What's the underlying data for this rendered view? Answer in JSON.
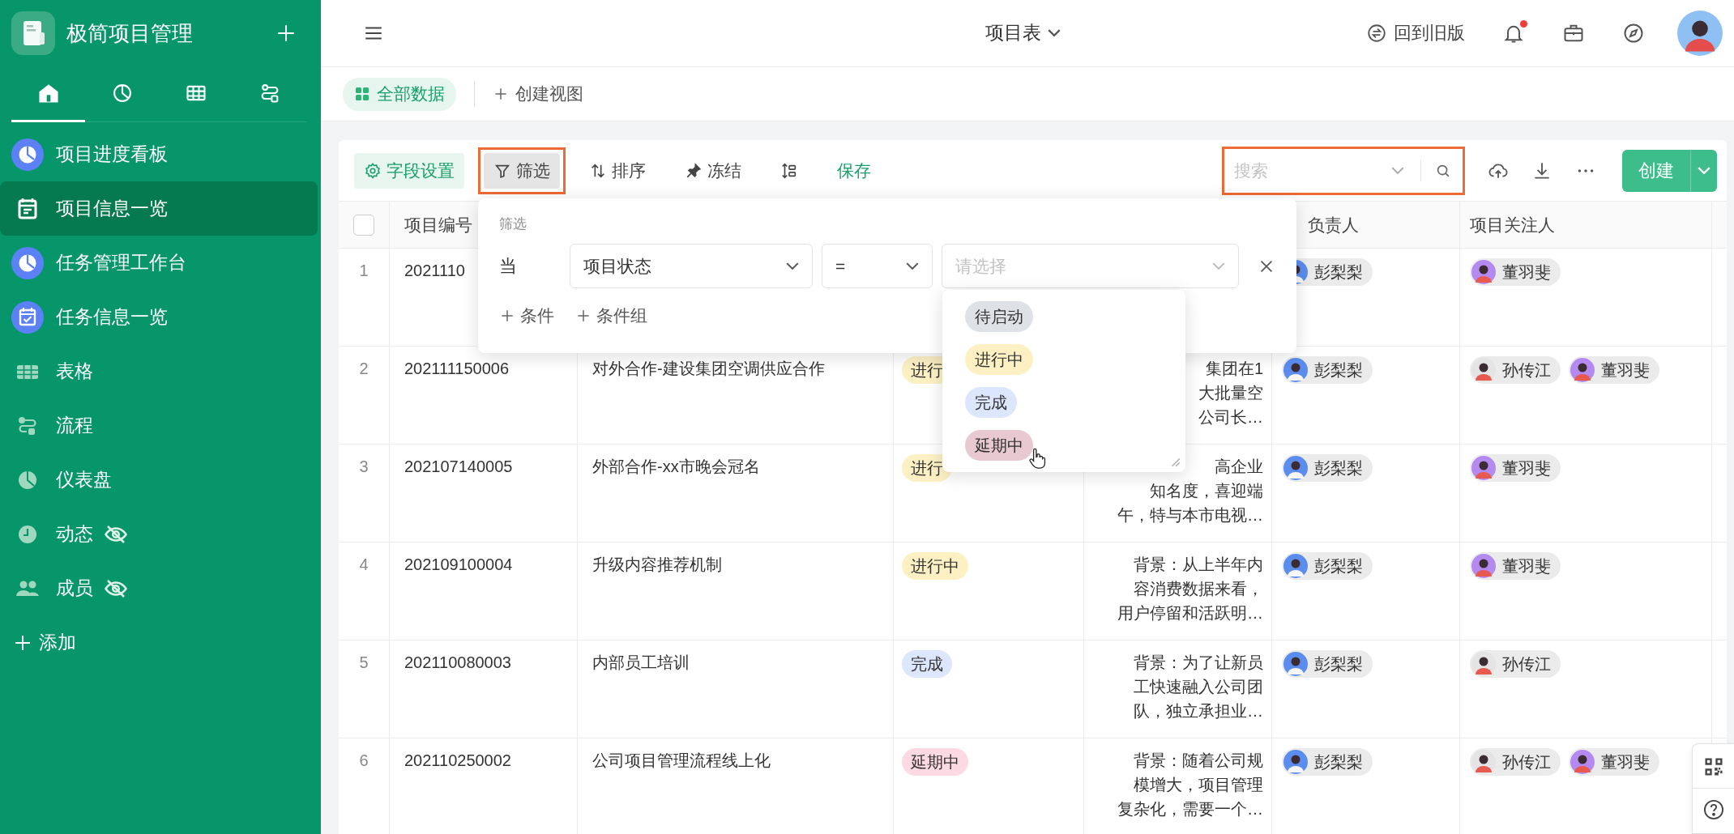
{
  "sidebar": {
    "app_title": "极简项目管理",
    "tabs": [
      {
        "kind": "home",
        "selected": true
      },
      {
        "kind": "chart",
        "selected": false
      },
      {
        "kind": "table",
        "selected": false
      },
      {
        "kind": "flow",
        "selected": false
      }
    ],
    "items": [
      {
        "label": "项目进度看板",
        "kind": "dashboard",
        "selected": false,
        "hidden": false
      },
      {
        "label": "项目信息一览",
        "kind": "form",
        "selected": true,
        "hidden": false
      },
      {
        "label": "任务管理工作台",
        "kind": "dashboard",
        "selected": false,
        "hidden": false
      },
      {
        "label": "任务信息一览",
        "kind": "task_form",
        "selected": false,
        "hidden": false
      },
      {
        "label": "表格",
        "kind": "table",
        "selected": false,
        "hidden": false
      },
      {
        "label": "流程",
        "kind": "flow",
        "selected": false,
        "hidden": false
      },
      {
        "label": "仪表盘",
        "kind": "chart",
        "selected": false,
        "hidden": false
      },
      {
        "label": "动态",
        "kind": "activity",
        "selected": false,
        "hidden": true
      },
      {
        "label": "成员",
        "kind": "members",
        "selected": false,
        "hidden": true
      }
    ],
    "add_label": "添加"
  },
  "topbar": {
    "title": "项目表",
    "old_version": "回到旧版",
    "notification_dot": true
  },
  "views": {
    "items": [
      {
        "label": "全部数据",
        "selected": true
      }
    ],
    "create_label": "创建视图"
  },
  "toolbar": {
    "tools": [
      {
        "kind": "fields",
        "label": "字段设置",
        "active": false,
        "highlighted": false
      },
      {
        "kind": "filter",
        "label": "筛选",
        "active": true,
        "highlighted": true
      },
      {
        "kind": "sort",
        "label": "排序",
        "active": false,
        "highlighted": false
      },
      {
        "kind": "freeze",
        "label": "冻结",
        "active": false,
        "highlighted": false
      },
      {
        "kind": "row_height",
        "active": false,
        "highlighted": false
      },
      {
        "kind": "save",
        "label": "保存",
        "active": false,
        "highlighted": false
      }
    ],
    "search": {
      "placeholder": "搜索",
      "highlighted": true
    },
    "create_label": "创建"
  },
  "table": {
    "select_all": {
      "checked": false
    },
    "column_headers": {
      "project_id": "项目编号",
      "manager": "负责人",
      "followers": "项目关注人"
    },
    "rows": [
      {
        "number": "1",
        "id": "2021110",
        "manager": {
          "name": "彭梨梨",
          "color": "#5b8def"
        },
        "followers": [
          {
            "name": "董羽斐",
            "color": "#b48af0"
          }
        ]
      },
      {
        "number": "2",
        "id": "202111150006",
        "name": "对外合作-建设集团空调供应合作",
        "status": {
          "label": "进行",
          "kind": "doing"
        },
        "background": [
          "集团在1",
          "大批量空",
          "公司长…"
        ],
        "manager": {
          "name": "彭梨梨",
          "color": "#5b8def"
        },
        "followers": [
          {
            "name": "孙传江",
            "color": "#e4e4e4"
          },
          {
            "name": "董羽斐",
            "color": "#b48af0"
          }
        ]
      },
      {
        "number": "3",
        "id": "202107140005",
        "name": "外部合作-xx市晚会冠名",
        "status": {
          "label": "进行",
          "kind": "doing"
        },
        "background": [
          "高企业",
          "知名度，喜迎端",
          "午，特与本市电视…"
        ],
        "manager": {
          "name": "彭梨梨",
          "color": "#5b8def"
        },
        "followers": [
          {
            "name": "董羽斐",
            "color": "#b48af0"
          }
        ]
      },
      {
        "number": "4",
        "id": "202109100004",
        "name": "升级内容推荐机制",
        "status": {
          "label": "进行中",
          "kind": "doing"
        },
        "background": [
          "背景：从上半年内",
          "容消费数据来看，",
          "用户停留和活跃明…"
        ],
        "manager": {
          "name": "彭梨梨",
          "color": "#5b8def"
        },
        "followers": [
          {
            "name": "董羽斐",
            "color": "#b48af0"
          }
        ]
      },
      {
        "number": "5",
        "id": "202110080003",
        "name": "内部员工培训",
        "status": {
          "label": "完成",
          "kind": "done"
        },
        "background": [
          "背景：为了让新员",
          "工快速融入公司团",
          "队，独立承担业…"
        ],
        "manager": {
          "name": "彭梨梨",
          "color": "#5b8def"
        },
        "followers": [
          {
            "name": "孙传江",
            "color": "#e4e4e4"
          }
        ]
      },
      {
        "number": "6",
        "id": "202110250002",
        "name": "公司项目管理流程线上化",
        "status": {
          "label": "延期中",
          "kind": "delayed"
        },
        "background": [
          "背景：随着公司规",
          "模增大，项目管理",
          "复杂化，需要一个…"
        ],
        "manager": {
          "name": "彭梨梨",
          "color": "#5b8def"
        },
        "followers": [
          {
            "name": "孙传江",
            "color": "#e4e4e4"
          },
          {
            "name": "董羽斐",
            "color": "#b48af0"
          }
        ]
      }
    ]
  },
  "filter_panel": {
    "title": "筛选",
    "when": "当",
    "field": "项目状态",
    "operator": "=",
    "value_placeholder": "请选择",
    "add_condition": "条件",
    "add_group": "条件组",
    "options": [
      {
        "label": "待启动",
        "kind": "pending",
        "hovered": false
      },
      {
        "label": "进行中",
        "kind": "doing",
        "hovered": false
      },
      {
        "label": "完成",
        "kind": "done",
        "hovered": false
      },
      {
        "label": "延期中",
        "kind": "delayed",
        "hovered": true
      }
    ]
  }
}
